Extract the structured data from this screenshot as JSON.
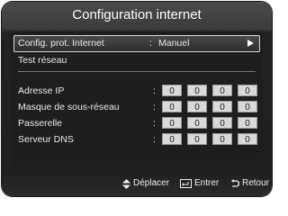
{
  "window": {
    "title": "Configuration internet"
  },
  "settings": {
    "config_label": "Config. prot. Internet",
    "colon": ":",
    "config_value": "Manuel",
    "test_label": "Test réseau"
  },
  "ip_fields": [
    {
      "label": "Adresse IP",
      "octets": [
        "0",
        "0",
        "0",
        "0"
      ]
    },
    {
      "label": "Masque de sous-réseau",
      "octets": [
        "0",
        "0",
        "0",
        "0"
      ]
    },
    {
      "label": "Passerelle",
      "octets": [
        "0",
        "0",
        "0",
        "0"
      ]
    },
    {
      "label": "Serveur DNS",
      "octets": [
        "0",
        "0",
        "0",
        "0"
      ]
    }
  ],
  "footer": {
    "move_label": "Déplacer",
    "enter_label": "Entrer",
    "return_label": "Retour",
    "move_icon": "up-down-arrows-icon",
    "enter_icon": "enter-icon",
    "return_icon": "return-icon"
  }
}
